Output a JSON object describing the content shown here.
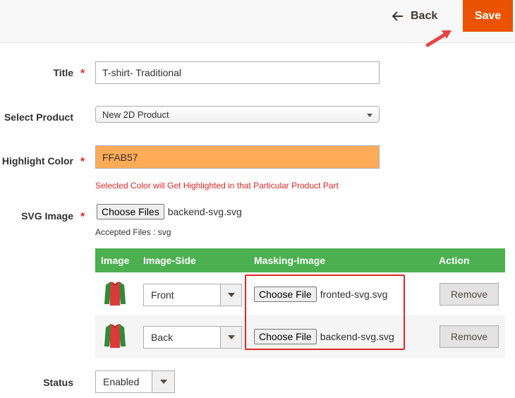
{
  "header": {
    "back_label": "Back",
    "save_label": "Save"
  },
  "form": {
    "title": {
      "label": "Title",
      "required": "*",
      "value": "T-shirt- Traditional"
    },
    "product": {
      "label": "Select Product",
      "value": "New 2D Product"
    },
    "highlight": {
      "label": "Highlight Color",
      "required": "*",
      "value": "FFAB57",
      "color": "#ffab57",
      "note": "Selected Color will Get Highlighted in that Particular Product Part"
    },
    "svg": {
      "label": "SVG Image",
      "required": "*",
      "button": "Choose Files",
      "file": "backend-svg.svg",
      "note": "Accepted Files : svg"
    },
    "status": {
      "label": "Status",
      "value": "Enabled"
    }
  },
  "grid": {
    "headers": [
      "Image",
      "Image-Side",
      "Masking-Image",
      "Action"
    ],
    "rows": [
      {
        "side": "Front",
        "file_button": "Choose File",
        "file": "fronted-svg.svg",
        "action": "Remove"
      },
      {
        "side": "Back",
        "file_button": "Choose File",
        "file": "backend-svg.svg",
        "action": "Remove"
      }
    ]
  },
  "colors": {
    "accent": "#eb5202",
    "grid_header": "#4caf50",
    "required": "#e22626",
    "highlight_value": "#ffab57"
  }
}
